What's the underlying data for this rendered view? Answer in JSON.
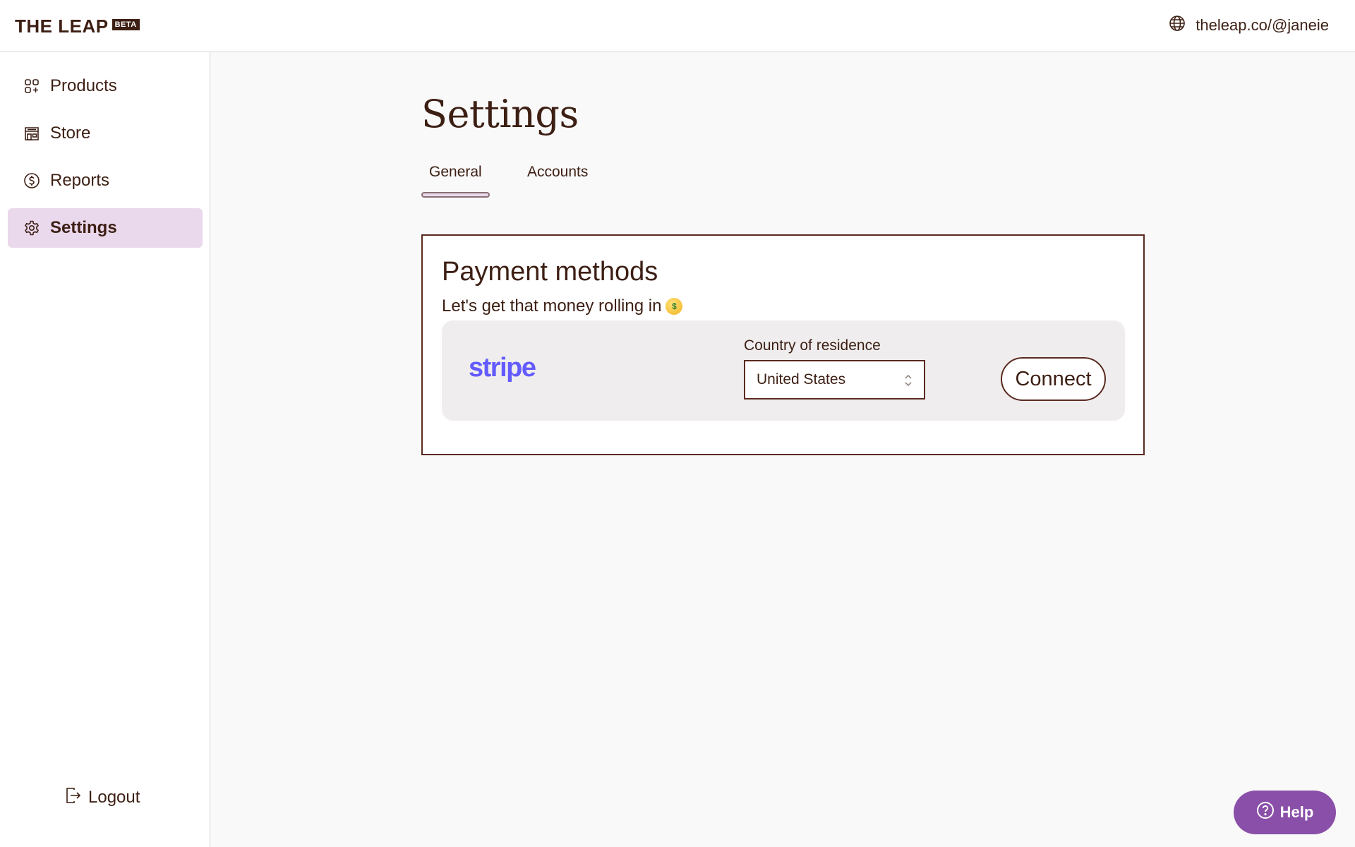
{
  "header": {
    "logo_text": "THE LEAP",
    "logo_badge": "BETA",
    "site_url": "theleap.co/@janeie",
    "site_icon": "globe-icon"
  },
  "sidebar": {
    "items": [
      {
        "label": "Products",
        "icon": "grid-plus-icon",
        "active": false
      },
      {
        "label": "Store",
        "icon": "storefront-icon",
        "active": false
      },
      {
        "label": "Reports",
        "icon": "dollar-circle-icon",
        "active": false
      },
      {
        "label": "Settings",
        "icon": "gear-icon",
        "active": true
      }
    ],
    "logout_label": "Logout",
    "logout_icon": "logout-icon"
  },
  "main": {
    "title": "Settings",
    "tabs": [
      {
        "label": "General",
        "active": true
      },
      {
        "label": "Accounts",
        "active": false
      }
    ]
  },
  "payment": {
    "title": "Payment methods",
    "subtitle": "Let's get that money rolling in",
    "subtitle_emoji": "money-mouth-face-icon",
    "provider": "stripe",
    "country_label": "Country of residence",
    "country_value": "United States",
    "connect_label": "Connect"
  },
  "help": {
    "label": "Help",
    "icon": "question-circle-icon"
  },
  "colors": {
    "text": "#3d1f14",
    "active_nav_bg": "#ead8ec",
    "stripe": "#635bff",
    "help_bg": "#8a4fa8",
    "panel_bg": "#efeded"
  }
}
